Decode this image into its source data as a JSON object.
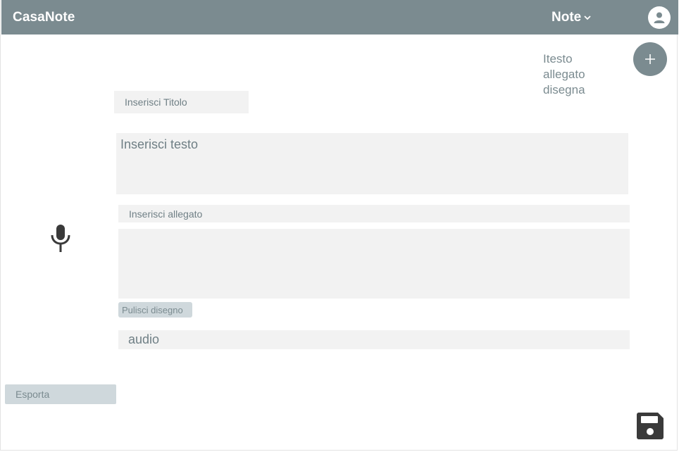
{
  "header": {
    "brand": "CasaNote",
    "menu_label": "Note",
    "icons": {
      "menu_chevron": "chevron-down-icon",
      "user": "user-avatar-icon"
    }
  },
  "note_type_menu": {
    "add_icon": "plus-icon",
    "options": [
      "Itesto",
      "allegato",
      "disegna"
    ]
  },
  "form": {
    "title_placeholder": "Inserisci Titolo",
    "text_placeholder": "Inserisci testo",
    "attachment_placeholder": "Inserisci allegato",
    "clear_drawing_label": "Pulisci disegno",
    "audio_label": "audio",
    "mic_icon": "microphone-icon"
  },
  "footer": {
    "export_label": "Esporta",
    "save_icon": "floppy-disk-icon"
  },
  "colors": {
    "primary": "#7b8b90",
    "field_bg": "#f2f2f2",
    "button_bg": "#cfd8dc",
    "icon_dark": "#3a3a3a"
  }
}
